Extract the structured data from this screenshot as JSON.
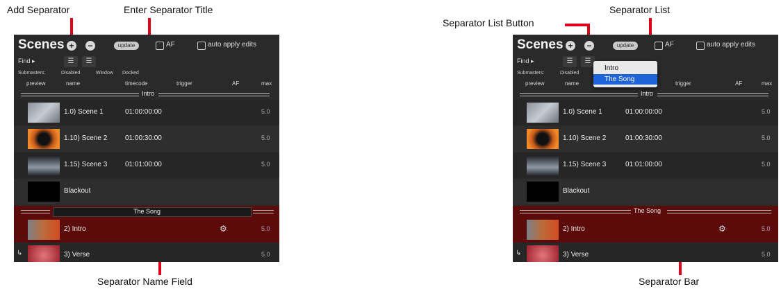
{
  "callouts": {
    "add_separator": "Add Separator",
    "enter_separator_title": "Enter Separator Title",
    "separator_name_field": "Separator Name Field",
    "separator_list_button": "Separator List Button",
    "separator_list": "Separator List",
    "separator_bar": "Separator Bar"
  },
  "scenes_panel": {
    "title": "Scenes",
    "add_glyph": "+",
    "remove_glyph": "−",
    "update_label": "update",
    "af_label": "AF",
    "auto_apply_label": "auto apply edits",
    "find_label": "Find ▸",
    "submasters_label": "Submasters:",
    "submaster_options": [
      "Disabled",
      "Window",
      "Docked"
    ],
    "columns": {
      "preview": "preview",
      "name": "name",
      "timecode": "timecode",
      "trigger": "trigger",
      "af": "AF",
      "max": "max"
    },
    "separator_1": "Intro",
    "separator_2": "The Song",
    "rows": [
      {
        "name": "1.0) Scene 1",
        "timecode": "01:00:00:00",
        "max": "5.0"
      },
      {
        "name": "1.10) Scene 2",
        "timecode": "01:00:30:00",
        "max": "5.0"
      },
      {
        "name": "1.15) Scene 3",
        "timecode": "01:01:00:00",
        "max": "5.0"
      },
      {
        "name": "Blackout",
        "timecode": "",
        "max": ""
      },
      {
        "name": "2) Intro",
        "timecode": "",
        "max": "5.0"
      },
      {
        "name": "3) Verse",
        "timecode": "",
        "max": "5.0"
      }
    ]
  },
  "separator_list_menu": {
    "items": [
      "Intro",
      "The Song"
    ],
    "selected": "The Song"
  },
  "colors": {
    "accent_red": "#e0001b",
    "selected_row": "#5c0b0b",
    "menu_highlight": "#1e63d8"
  }
}
